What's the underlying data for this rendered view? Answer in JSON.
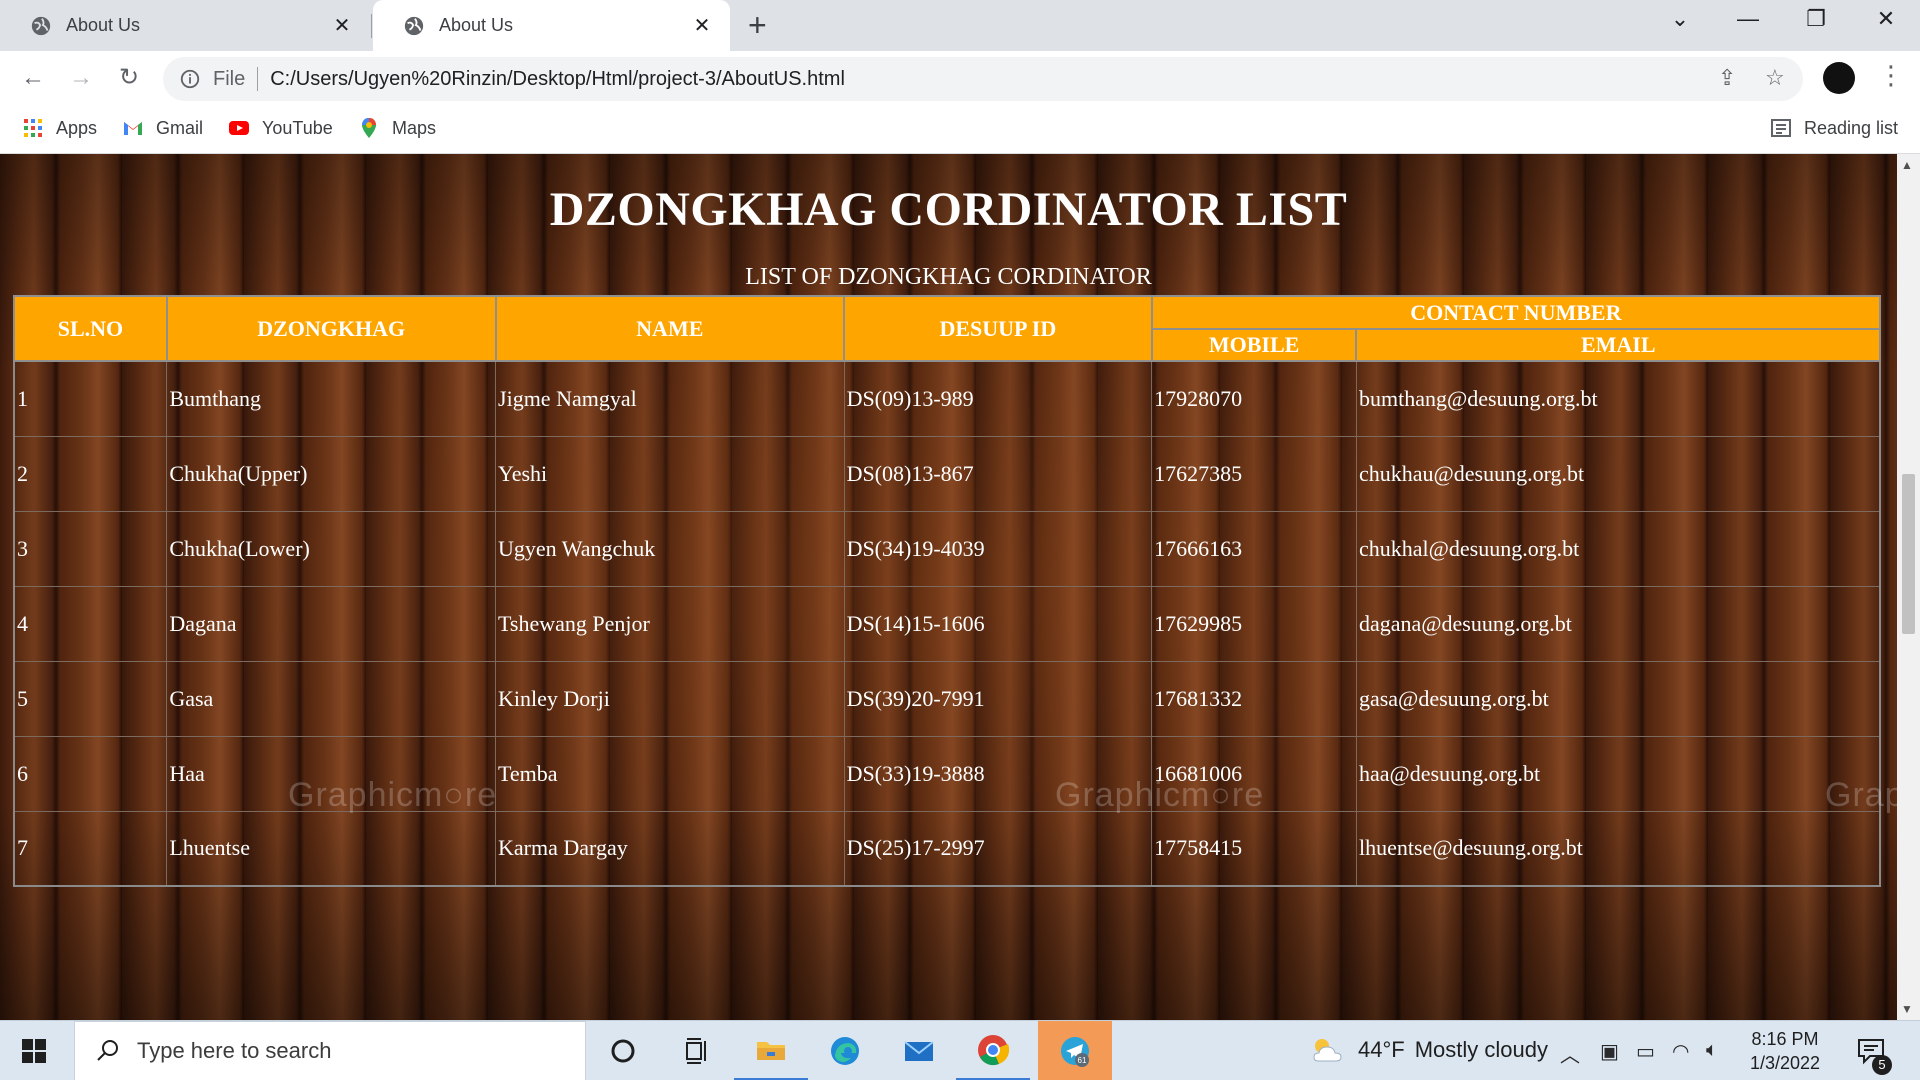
{
  "browser": {
    "tabs": [
      {
        "title": "About Us",
        "active": false
      },
      {
        "title": "About Us",
        "active": true
      }
    ],
    "address": {
      "scheme": "File",
      "url": "C:/Users/Ugyen%20Rinzin/Desktop/Html/project-3/AboutUS.html"
    },
    "bookmarks": [
      {
        "label": "Apps",
        "icon": "apps-grid-icon"
      },
      {
        "label": "Gmail",
        "icon": "gmail-icon"
      },
      {
        "label": "YouTube",
        "icon": "youtube-icon"
      },
      {
        "label": "Maps",
        "icon": "maps-icon"
      }
    ],
    "reading_list": "Reading list"
  },
  "page": {
    "title": "DZONGKHAG CORDINATOR LIST",
    "caption": "LIST OF DZONGKHAG CORDINATOR",
    "headers": {
      "sl_no": "SL.NO",
      "dzongkhag": "DZONGKHAG",
      "name": "NAME",
      "desuup_id": "DESUUP ID",
      "contact": "CONTACT NUMBER",
      "mobile": "MOBILE",
      "email": "EMAIL"
    },
    "rows": [
      {
        "sl": "1",
        "dzongkhag": "Bumthang",
        "name": "Jigme Namgyal",
        "id": "DS(09)13-989",
        "mobile": "17928070",
        "email": "bumthang@desuung.org.bt"
      },
      {
        "sl": "2",
        "dzongkhag": "Chukha(Upper)",
        "name": "Yeshi",
        "id": "DS(08)13-867",
        "mobile": "17627385",
        "email": "chukhau@desuung.org.bt"
      },
      {
        "sl": "3",
        "dzongkhag": "Chukha(Lower)",
        "name": "Ugyen Wangchuk",
        "id": "DS(34)19-4039",
        "mobile": "17666163",
        "email": "chukhal@desuung.org.bt"
      },
      {
        "sl": "4",
        "dzongkhag": "Dagana",
        "name": "Tshewang Penjor",
        "id": "DS(14)15-1606",
        "mobile": "17629985",
        "email": "dagana@desuung.org.bt"
      },
      {
        "sl": "5",
        "dzongkhag": "Gasa",
        "name": "Kinley Dorji",
        "id": "DS(39)20-7991",
        "mobile": "17681332",
        "email": "gasa@desuung.org.bt"
      },
      {
        "sl": "6",
        "dzongkhag": "Haa",
        "name": "Temba",
        "id": "DS(33)19-3888",
        "mobile": "16681006",
        "email": "haa@desuung.org.bt"
      },
      {
        "sl": "7",
        "dzongkhag": "Lhuentse",
        "name": "Karma Dargay",
        "id": "DS(25)17-2997",
        "mobile": "17758415",
        "email": "lhuentse@desuung.org.bt"
      }
    ],
    "watermark": [
      "Graphicm",
      "re",
      "Graphicm",
      "re",
      "Grap"
    ]
  },
  "taskbar": {
    "search_placeholder": "Type here to search",
    "weather_temp": "44°F",
    "weather_text": "Mostly cloudy",
    "time": "8:16 PM",
    "date": "1/3/2022",
    "telegram_badge": "61",
    "notification_count": "5"
  },
  "colors": {
    "header_bg": "#ffa500",
    "taskbar_bg": "#dbe6f1"
  }
}
